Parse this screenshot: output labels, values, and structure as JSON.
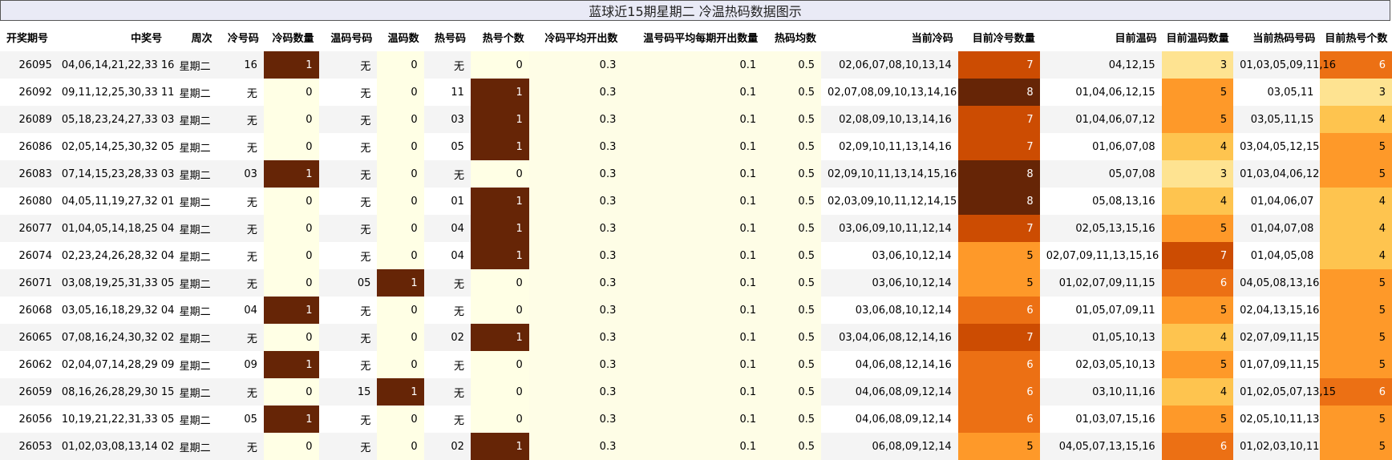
{
  "title": "蓝球近15期星期二 冷温热码数据图示",
  "headers": [
    "开奖期号",
    "中奖号",
    "周次",
    "冷号码",
    "冷码数量",
    "温码号码",
    "温码数",
    "热号码",
    "热号个数",
    "冷码平均开出数",
    "温号码平均每期开出数量",
    "热码均数",
    "当前冷码",
    "目前冷号数量",
    "目前温码",
    "目前温码数量",
    "当前热码号码",
    "目前热号个数"
  ],
  "rows": [
    {
      "issue": "26095",
      "numbers": "04,06,14,21,22,33 16",
      "week": "星期二",
      "cold": "16",
      "cold_count": 1,
      "warm": "无",
      "warm_count": 0,
      "hot": "无",
      "hot_count": 0,
      "cold_avg": "0.3",
      "warm_avg": "0.1",
      "hot_avg": "0.5",
      "cur_cold": "02,06,07,08,10,13,14",
      "cur_cold_count": 7,
      "cur_warm": "04,12,15",
      "cur_warm_count": 3,
      "cur_hot": "01,03,05,09,11,16",
      "cur_hot_count": 6
    },
    {
      "issue": "26092",
      "numbers": "09,11,12,25,30,33 11",
      "week": "星期二",
      "cold": "无",
      "cold_count": 0,
      "warm": "无",
      "warm_count": 0,
      "hot": "11",
      "hot_count": 1,
      "cold_avg": "0.3",
      "warm_avg": "0.1",
      "hot_avg": "0.5",
      "cur_cold": "02,07,08,09,10,13,14,16",
      "cur_cold_count": 8,
      "cur_warm": "01,04,06,12,15",
      "cur_warm_count": 5,
      "cur_hot": "03,05,11",
      "cur_hot_count": 3
    },
    {
      "issue": "26089",
      "numbers": "05,18,23,24,27,33 03",
      "week": "星期二",
      "cold": "无",
      "cold_count": 0,
      "warm": "无",
      "warm_count": 0,
      "hot": "03",
      "hot_count": 1,
      "cold_avg": "0.3",
      "warm_avg": "0.1",
      "hot_avg": "0.5",
      "cur_cold": "02,08,09,10,13,14,16",
      "cur_cold_count": 7,
      "cur_warm": "01,04,06,07,12",
      "cur_warm_count": 5,
      "cur_hot": "03,05,11,15",
      "cur_hot_count": 4
    },
    {
      "issue": "26086",
      "numbers": "02,05,14,25,30,32 05",
      "week": "星期二",
      "cold": "无",
      "cold_count": 0,
      "warm": "无",
      "warm_count": 0,
      "hot": "05",
      "hot_count": 1,
      "cold_avg": "0.3",
      "warm_avg": "0.1",
      "hot_avg": "0.5",
      "cur_cold": "02,09,10,11,13,14,16",
      "cur_cold_count": 7,
      "cur_warm": "01,06,07,08",
      "cur_warm_count": 4,
      "cur_hot": "03,04,05,12,15",
      "cur_hot_count": 5
    },
    {
      "issue": "26083",
      "numbers": "07,14,15,23,28,33 03",
      "week": "星期二",
      "cold": "03",
      "cold_count": 1,
      "warm": "无",
      "warm_count": 0,
      "hot": "无",
      "hot_count": 0,
      "cold_avg": "0.3",
      "warm_avg": "0.1",
      "hot_avg": "0.5",
      "cur_cold": "02,09,10,11,13,14,15,16",
      "cur_cold_count": 8,
      "cur_warm": "05,07,08",
      "cur_warm_count": 3,
      "cur_hot": "01,03,04,06,12",
      "cur_hot_count": 5
    },
    {
      "issue": "26080",
      "numbers": "04,05,11,19,27,32 01",
      "week": "星期二",
      "cold": "无",
      "cold_count": 0,
      "warm": "无",
      "warm_count": 0,
      "hot": "01",
      "hot_count": 1,
      "cold_avg": "0.3",
      "warm_avg": "0.1",
      "hot_avg": "0.5",
      "cur_cold": "02,03,09,10,11,12,14,15",
      "cur_cold_count": 8,
      "cur_warm": "05,08,13,16",
      "cur_warm_count": 4,
      "cur_hot": "01,04,06,07",
      "cur_hot_count": 4
    },
    {
      "issue": "26077",
      "numbers": "01,04,05,14,18,25 04",
      "week": "星期二",
      "cold": "无",
      "cold_count": 0,
      "warm": "无",
      "warm_count": 0,
      "hot": "04",
      "hot_count": 1,
      "cold_avg": "0.3",
      "warm_avg": "0.1",
      "hot_avg": "0.5",
      "cur_cold": "03,06,09,10,11,12,14",
      "cur_cold_count": 7,
      "cur_warm": "02,05,13,15,16",
      "cur_warm_count": 5,
      "cur_hot": "01,04,07,08",
      "cur_hot_count": 4
    },
    {
      "issue": "26074",
      "numbers": "02,23,24,26,28,32 04",
      "week": "星期二",
      "cold": "无",
      "cold_count": 0,
      "warm": "无",
      "warm_count": 0,
      "hot": "04",
      "hot_count": 1,
      "cold_avg": "0.3",
      "warm_avg": "0.1",
      "hot_avg": "0.5",
      "cur_cold": "03,06,10,12,14",
      "cur_cold_count": 5,
      "cur_warm": "02,07,09,11,13,15,16",
      "cur_warm_count": 7,
      "cur_hot": "01,04,05,08",
      "cur_hot_count": 4
    },
    {
      "issue": "26071",
      "numbers": "03,08,19,25,31,33 05",
      "week": "星期二",
      "cold": "无",
      "cold_count": 0,
      "warm": "05",
      "warm_count": 1,
      "hot": "无",
      "hot_count": 0,
      "cold_avg": "0.3",
      "warm_avg": "0.1",
      "hot_avg": "0.5",
      "cur_cold": "03,06,10,12,14",
      "cur_cold_count": 5,
      "cur_warm": "01,02,07,09,11,15",
      "cur_warm_count": 6,
      "cur_hot": "04,05,08,13,16",
      "cur_hot_count": 5
    },
    {
      "issue": "26068",
      "numbers": "03,05,16,18,29,32 04",
      "week": "星期二",
      "cold": "04",
      "cold_count": 1,
      "warm": "无",
      "warm_count": 0,
      "hot": "无",
      "hot_count": 0,
      "cold_avg": "0.3",
      "warm_avg": "0.1",
      "hot_avg": "0.5",
      "cur_cold": "03,06,08,10,12,14",
      "cur_cold_count": 6,
      "cur_warm": "01,05,07,09,11",
      "cur_warm_count": 5,
      "cur_hot": "02,04,13,15,16",
      "cur_hot_count": 5
    },
    {
      "issue": "26065",
      "numbers": "07,08,16,24,30,32 02",
      "week": "星期二",
      "cold": "无",
      "cold_count": 0,
      "warm": "无",
      "warm_count": 0,
      "hot": "02",
      "hot_count": 1,
      "cold_avg": "0.3",
      "warm_avg": "0.1",
      "hot_avg": "0.5",
      "cur_cold": "03,04,06,08,12,14,16",
      "cur_cold_count": 7,
      "cur_warm": "01,05,10,13",
      "cur_warm_count": 4,
      "cur_hot": "02,07,09,11,15",
      "cur_hot_count": 5
    },
    {
      "issue": "26062",
      "numbers": "02,04,07,14,28,29 09",
      "week": "星期二",
      "cold": "09",
      "cold_count": 1,
      "warm": "无",
      "warm_count": 0,
      "hot": "无",
      "hot_count": 0,
      "cold_avg": "0.3",
      "warm_avg": "0.1",
      "hot_avg": "0.5",
      "cur_cold": "04,06,08,12,14,16",
      "cur_cold_count": 6,
      "cur_warm": "02,03,05,10,13",
      "cur_warm_count": 5,
      "cur_hot": "01,07,09,11,15",
      "cur_hot_count": 5
    },
    {
      "issue": "26059",
      "numbers": "08,16,26,28,29,30 15",
      "week": "星期二",
      "cold": "无",
      "cold_count": 0,
      "warm": "15",
      "warm_count": 1,
      "hot": "无",
      "hot_count": 0,
      "cold_avg": "0.3",
      "warm_avg": "0.1",
      "hot_avg": "0.5",
      "cur_cold": "04,06,08,09,12,14",
      "cur_cold_count": 6,
      "cur_warm": "03,10,11,16",
      "cur_warm_count": 4,
      "cur_hot": "01,02,05,07,13,15",
      "cur_hot_count": 6
    },
    {
      "issue": "26056",
      "numbers": "10,19,21,22,31,33 05",
      "week": "星期二",
      "cold": "05",
      "cold_count": 1,
      "warm": "无",
      "warm_count": 0,
      "hot": "无",
      "hot_count": 0,
      "cold_avg": "0.3",
      "warm_avg": "0.1",
      "hot_avg": "0.5",
      "cur_cold": "04,06,08,09,12,14",
      "cur_cold_count": 6,
      "cur_warm": "01,03,07,15,16",
      "cur_warm_count": 5,
      "cur_hot": "02,05,10,11,13",
      "cur_hot_count": 5
    },
    {
      "issue": "26053",
      "numbers": "01,02,03,08,13,14 02",
      "week": "星期二",
      "cold": "无",
      "cold_count": 0,
      "warm": "无",
      "warm_count": 0,
      "hot": "02",
      "hot_count": 1,
      "cold_avg": "0.3",
      "warm_avg": "0.1",
      "hot_avg": "0.5",
      "cur_cold": "06,08,09,12,14",
      "cur_cold_count": 5,
      "cur_warm": "04,05,07,13,15,16",
      "cur_warm_count": 6,
      "cur_hot": "01,02,03,10,11",
      "cur_hot_count": 5
    }
  ],
  "colors": {
    "binary_on": "#662506",
    "binary_off": "#ffffe5",
    "yellow_col": "#fefde6",
    "row_odd": "#f4f4f4",
    "heat_scale": [
      "#ffffe5",
      "#fee391",
      "#fec44f",
      "#fe9929",
      "#ec7014",
      "#cc4c02",
      "#662506"
    ]
  }
}
